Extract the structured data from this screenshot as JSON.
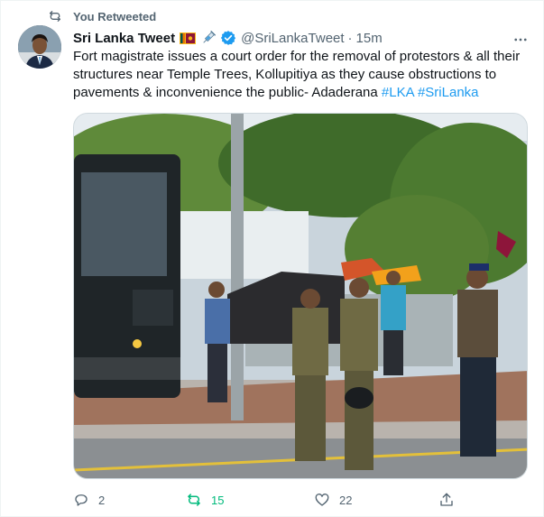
{
  "retweet_banner": {
    "text": "You Retweeted",
    "icon": "retweet-icon"
  },
  "author": {
    "display_name": "Sri Lanka Tweet",
    "handle": "@SriLankaTweet",
    "separator": "·",
    "time": "15m",
    "badges": [
      "sri-lanka-flag-icon",
      "syringe-icon",
      "verified-badge-icon"
    ]
  },
  "tweet": {
    "text": "Fort magistrate issues a court order for the removal of protestors & all their structures near Temple Trees, Kollupitiya as they cause obstructions to pavements & inconvenience the public- Adaderana",
    "hashtags": [
      "#LKA",
      "#SriLanka"
    ]
  },
  "media": {
    "type": "photo",
    "depiction": "police officers near a bus and protest tents on a street"
  },
  "actions": {
    "reply": {
      "count": "2",
      "icon": "reply-icon"
    },
    "retweet": {
      "count": "15",
      "icon": "retweet-icon",
      "active": true,
      "color": "#00ba7c"
    },
    "like": {
      "count": "22",
      "icon": "heart-icon"
    },
    "share": {
      "icon": "share-icon"
    }
  },
  "colors": {
    "link": "#1d9bf0",
    "secondary_text": "#536471",
    "verified": "#1d9bf0"
  }
}
